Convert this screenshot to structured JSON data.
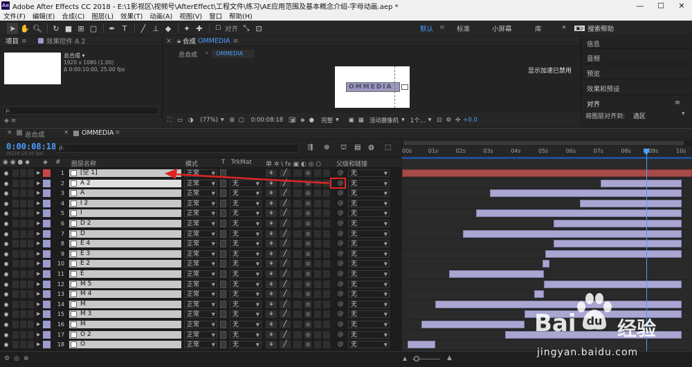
{
  "titlebar": {
    "title": "Adobe After Effects CC 2018 - E:\\1影视区\\视频号\\AfterEffect\\工程文件\\练习\\AE应用范围及基本概念介绍-字母动画.aep *",
    "minimize": "—",
    "maximize": "☐",
    "close": "✕"
  },
  "menu": [
    "文件(F)",
    "编辑(E)",
    "合成(C)",
    "图层(L)",
    "效果(T)",
    "动画(A)",
    "视图(V)",
    "窗口",
    "帮助(H)"
  ],
  "toolbar": {
    "snap_label": "对齐",
    "workspaces": [
      "默认",
      "标准",
      "小屏幕",
      "库"
    ],
    "more": "»",
    "search_help": "搜索帮助"
  },
  "project_panel": {
    "tab_project": "项目",
    "tab_effects": "效果控件 A 2",
    "comp_name": "总合成 ▾",
    "comp_info1": "1920 x 1080 (1.00)",
    "comp_info2": "Δ 0:00:10:00, 25.00 fps",
    "search_placeholder": "ρ."
  },
  "comp_panel": {
    "tab_label": "合成",
    "tab_comp_name": "OMMEDIA",
    "crumb_root": "总合成",
    "crumb_current": "OMMEDIA",
    "accel_msg": "显示加速已禁用",
    "zoom": "(77%)",
    "timecode": "0:00:08:18",
    "quality": "完整",
    "camera": "活动摄像机",
    "views": "1个...",
    "exposure": "+0.0",
    "preview_text": "OMMEDIA"
  },
  "right_panel": {
    "items": [
      "信息",
      "音频",
      "预览",
      "效果和预设",
      "对齐"
    ],
    "align_label": "将图层对齐到:",
    "align_value": "选区"
  },
  "timeline": {
    "tab1": "总合成",
    "tab2": "OMMEDIA",
    "timecode": "0:00:08:18",
    "timecode_sub": "00218 (25.00 fps)",
    "search_placeholder": "ρ.",
    "col_hash": "#",
    "col_name": "图层名称",
    "col_mode": "模式",
    "col_t": "T",
    "col_trkmat": "TrkMat",
    "col_parent": "父级和链接",
    "switch_hdr": "单 ✲ \\ fx ▣ ◐ ◎ ⬡",
    "ruler_ticks": [
      "00s",
      "01s",
      "02s",
      "03s",
      "04s",
      "05s",
      "06s",
      "07s",
      "08s",
      "09s",
      "10s"
    ]
  },
  "layers": [
    {
      "num": "1",
      "name": "[空 1]",
      "mode": "正常",
      "trk": "",
      "parent": "无",
      "color": "#c84545",
      "start": 0.0,
      "end": 10.0
    },
    {
      "num": "2",
      "name": "A 2",
      "mode": "正常",
      "trk": "无",
      "parent": "无",
      "color": "#9b9bd0",
      "start": 7.05,
      "end": 10.0
    },
    {
      "num": "3",
      "name": "A",
      "mode": "正常",
      "trk": "无",
      "parent": "无",
      "color": "#9b9bd0",
      "start": 3.05,
      "end": 10.0
    },
    {
      "num": "4",
      "name": "I 2",
      "mode": "正常",
      "trk": "无",
      "parent": "无",
      "color": "#9b9bd0",
      "start": 6.3,
      "end": 10.0
    },
    {
      "num": "5",
      "name": "I",
      "mode": "正常",
      "trk": "无",
      "parent": "无",
      "color": "#9b9bd0",
      "start": 2.55,
      "end": 10.0
    },
    {
      "num": "6",
      "name": "D 2",
      "mode": "正常",
      "trk": "无",
      "parent": "无",
      "color": "#9b9bd0",
      "start": 5.35,
      "end": 10.0
    },
    {
      "num": "7",
      "name": "D",
      "mode": "正常",
      "trk": "无",
      "parent": "无",
      "color": "#9b9bd0",
      "start": 2.05,
      "end": 10.0
    },
    {
      "num": "8",
      "name": "E 4",
      "mode": "正常",
      "trk": "无",
      "parent": "无",
      "color": "#9b9bd0",
      "start": 5.35,
      "end": 10.0
    },
    {
      "num": "9",
      "name": "E 3",
      "mode": "正常",
      "trk": "无",
      "parent": "无",
      "color": "#9b9bd0",
      "start": 5.05,
      "end": 10.0
    },
    {
      "num": "10",
      "name": "E 2",
      "mode": "正常",
      "trk": "无",
      "parent": "无",
      "color": "#9b9bd0",
      "start": 4.95,
      "end": 5.2
    },
    {
      "num": "11",
      "name": "E",
      "mode": "正常",
      "trk": "无",
      "parent": "无",
      "color": "#9b9bd0",
      "start": 1.55,
      "end": 5.0
    },
    {
      "num": "12",
      "name": "M 5",
      "mode": "正常",
      "trk": "无",
      "parent": "无",
      "color": "#9b9bd0",
      "start": 5.0,
      "end": 10.0
    },
    {
      "num": "13",
      "name": "M 4",
      "mode": "正常",
      "trk": "无",
      "parent": "无",
      "color": "#9b9bd0",
      "start": 4.65,
      "end": 5.0
    },
    {
      "num": "14",
      "name": "M",
      "mode": "正常",
      "trk": "无",
      "parent": "无",
      "color": "#9b9bd0",
      "start": 1.05,
      "end": 10.0
    },
    {
      "num": "15",
      "name": "M 3",
      "mode": "正常",
      "trk": "无",
      "parent": "无",
      "color": "#9b9bd0",
      "start": 4.3,
      "end": 10.0
    },
    {
      "num": "16",
      "name": "M",
      "mode": "正常",
      "trk": "无",
      "parent": "无",
      "color": "#9b9bd0",
      "start": 0.55,
      "end": 4.3
    },
    {
      "num": "17",
      "name": "O 2",
      "mode": "正常",
      "trk": "无",
      "parent": "无",
      "color": "#9b9bd0",
      "start": 3.6,
      "end": 10.0
    },
    {
      "num": "18",
      "name": "O",
      "mode": "正常",
      "trk": "无",
      "parent": "无",
      "color": "#9b9bd0",
      "start": 0.05,
      "end": 1.05
    }
  ],
  "playhead_seconds": 8.72,
  "watermark": {
    "brand": "Bai",
    "brand2": "经验",
    "url": "jingyan.baidu.com"
  },
  "colors": {
    "accent": "#4a9eff",
    "layer_bar": "#a9a6d2",
    "null_bar": "#a74a4a",
    "annotation": "#e02424"
  }
}
